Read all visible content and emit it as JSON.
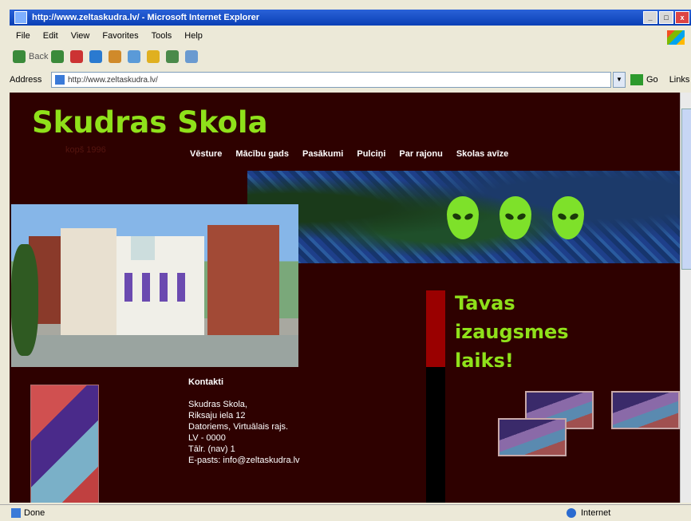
{
  "window": {
    "title": "http://www.zeltaskudra.lv/ - Microsoft Internet Explorer"
  },
  "menu": [
    "File",
    "Edit",
    "View",
    "Favorites",
    "Tools",
    "Help"
  ],
  "toolbar": {
    "back_label": "Back",
    "icons": [
      "back-icon",
      "forward-icon",
      "stop-icon",
      "refresh-icon",
      "home-icon",
      "search-icon",
      "favorites-icon",
      "history-icon",
      "mail-icon"
    ]
  },
  "address": {
    "label": "Address",
    "url": "http://www.zeltaskudra.lv/",
    "go_label": "Go",
    "links_label": "Links"
  },
  "page": {
    "site_title": "Skudras Skola",
    "subtitle": "kopš 1996",
    "nav": [
      "Vēsture",
      "Mācību gads",
      "Pasākumi",
      "Pulciņi",
      "Par rajonu",
      "Skolas avīze"
    ],
    "slogan": "Tavas\nizaugsmes\nlaiks!",
    "contact": {
      "title": "Kontakti",
      "lines": [
        "Skudras Skola,",
        "Riksaju iela 12",
        "Datoriems, Virtuālais rajs.",
        "LV - 0000",
        "Tālr. (nav) 1",
        "E-pasts: info@zeltaskudra.lv"
      ]
    },
    "colors": {
      "background": "#2e0100",
      "title_green": "#8fe11a",
      "slogan_bar": "#9a0000"
    }
  },
  "status": {
    "text": "Done",
    "zone": "Internet"
  }
}
